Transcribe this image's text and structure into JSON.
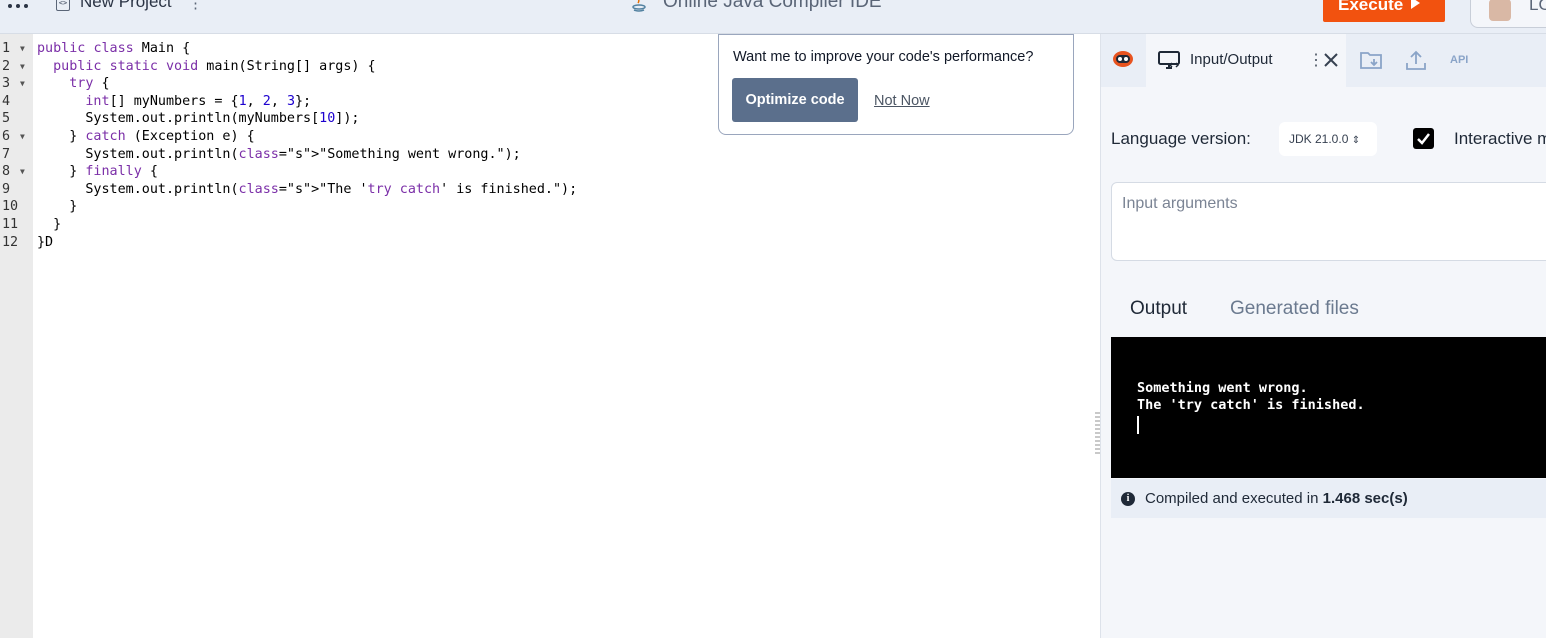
{
  "topbar": {
    "project_name": "New Project",
    "project_menu": "⋮",
    "app_title": "Online Java Compiler IDE",
    "execute_label": "Execute",
    "login_label": "LO"
  },
  "editor": {
    "line_numbers": [
      "1",
      "2",
      "3",
      "4",
      "5",
      "6",
      "7",
      "8",
      "9",
      "10",
      "11",
      "12"
    ],
    "lines": [
      "public class Main {",
      "  public static void main(String[] args) {",
      "    try {",
      "      int[] myNumbers = {1, 2, 3};",
      "      System.out.println(myNumbers[10]);",
      "    } catch (Exception e) {",
      "      System.out.println(\"Something went wrong.\");",
      "    } finally {",
      "      System.out.println(\"The 'try catch' is finished.\");",
      "    }",
      "  }",
      "}D"
    ]
  },
  "popup": {
    "question": "Want me to improve your code's performance?",
    "optimize_label": "Optimize code",
    "dismiss_label": "Not Now"
  },
  "panel": {
    "tab_label": "Input/Output",
    "tab_menu": "⋮",
    "api_label": "API",
    "language_label": "Language version:",
    "jdk_value": "JDK 21.0.0",
    "interactive_label": "Interactive mode",
    "args_placeholder": "Input arguments",
    "output_tab": "Output",
    "files_tab": "Generated files",
    "output_lines": [
      "Something went wrong.",
      "The 'try catch' is finished."
    ],
    "status_prefix": "Compiled and executed in ",
    "status_time": "1.468 sec(s)"
  },
  "colors": {
    "execute": "#f2520f",
    "optimize": "#5b6f8c",
    "console_bg": "#000000"
  }
}
